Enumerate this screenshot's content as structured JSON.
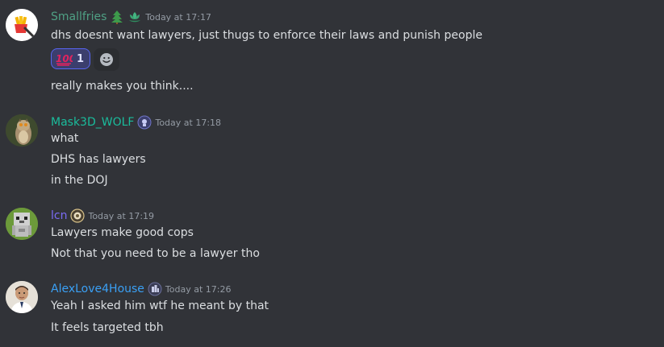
{
  "messages": [
    {
      "username": "Smallfries",
      "username_color": "#4fa084",
      "badge_icons": [
        "christmas-tree-icon",
        "lotus-icon"
      ],
      "timestamp": "Today at 17:17",
      "lines": [
        "dhs doesnt want lawyers, just thugs to enforce their laws and punish people",
        "really makes you think...."
      ],
      "reactions": [
        {
          "emoji": "hundred-points-icon",
          "count": "1"
        }
      ]
    },
    {
      "username": "Mask3D_WOLF",
      "username_color": "#1abc9c",
      "badge_icons": [
        "server-tag-icon"
      ],
      "timestamp": "Today at 17:18",
      "lines": [
        "what",
        "DHS has lawyers",
        "in the DOJ"
      ]
    },
    {
      "username": "lcn",
      "username_color": "#7b6cf6",
      "badge_icons": [
        "server-tag-icon"
      ],
      "timestamp": "Today at 17:19",
      "lines": [
        "Lawyers make good cops",
        "Not that you need to be a lawyer tho"
      ]
    },
    {
      "username": "AlexLove4House",
      "username_color": "#3aa0f5",
      "badge_icons": [
        "building-tag-icon"
      ],
      "timestamp": "Today at 17:26",
      "lines": [
        "Yeah I asked him wtf he meant by that",
        "It feels targeted tbh"
      ]
    }
  ]
}
